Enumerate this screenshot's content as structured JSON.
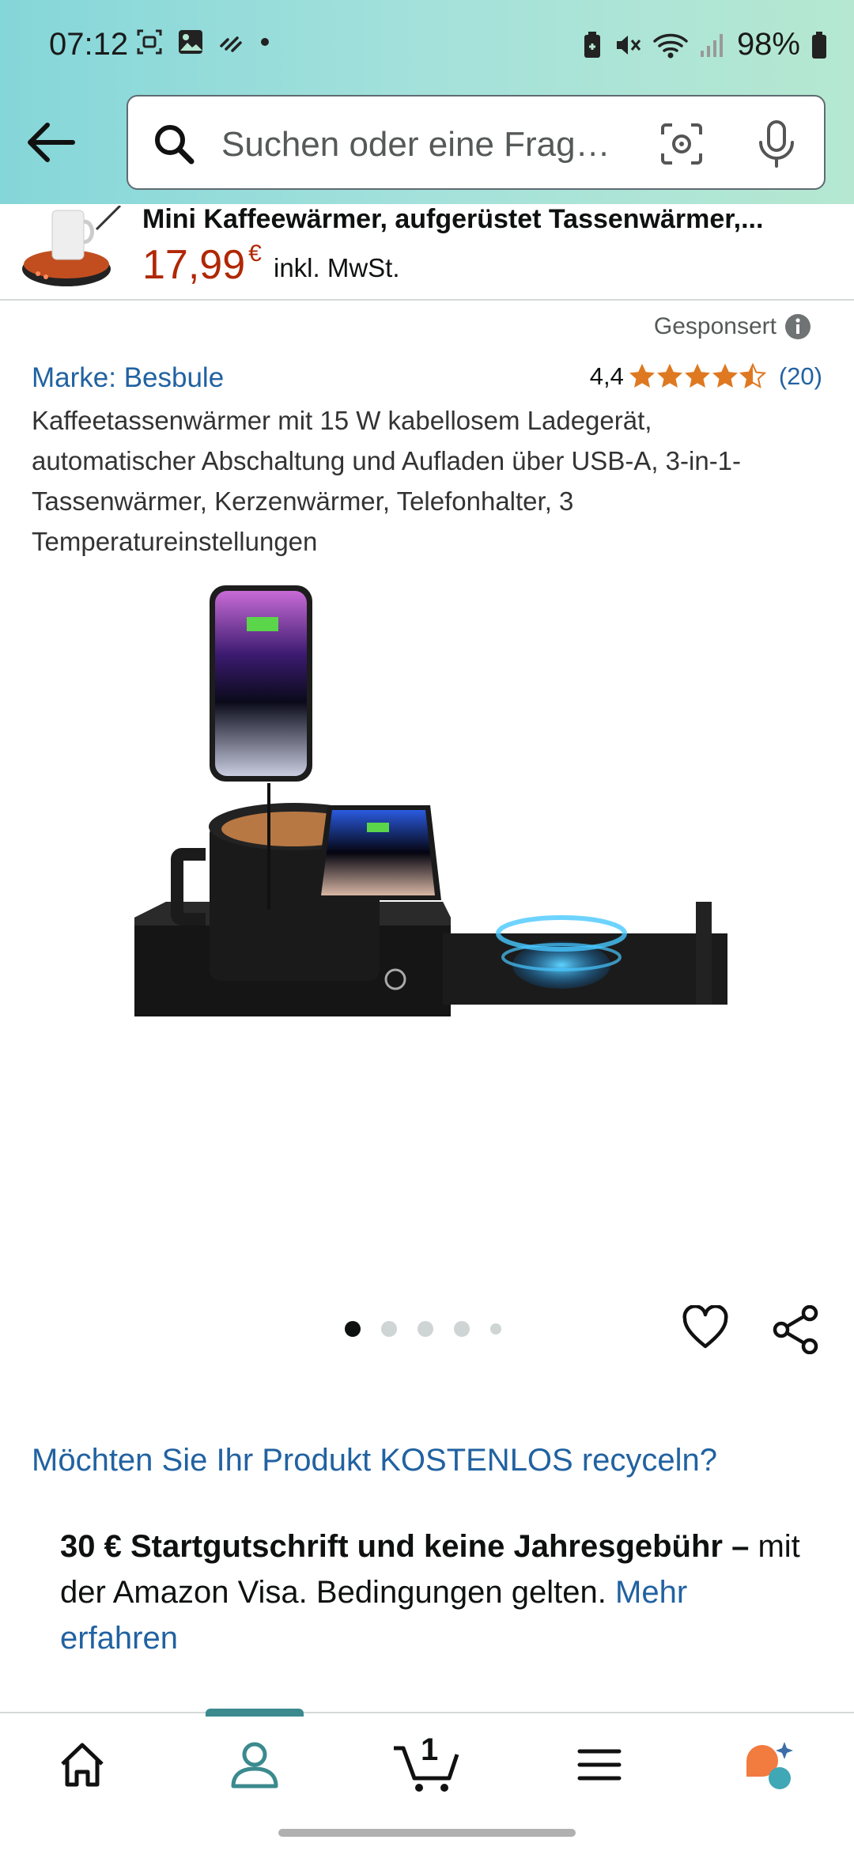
{
  "status_bar": {
    "time": "07:12",
    "battery": "98%"
  },
  "search": {
    "placeholder": "Suchen oder eine Frag…"
  },
  "sticky_product": {
    "title": "Mini Kaffeewärmer, aufgerüstet Tassenwärmer,...",
    "price": "17,99",
    "currency": "€",
    "vat_note": "inkl. MwSt."
  },
  "sponsored_label": "Gesponsert",
  "brand": "Marke: Besbule",
  "rating": {
    "value": "4,4",
    "stars": 4.5,
    "count": "(20)"
  },
  "product_title": "Kaffeetassenwärmer mit 15 W kabellosem Ladegerät, automatischer Abschaltung und Aufladen über USB-A, 3-in-1-Tassenwärmer, Kerzenwärmer, Telefonhalter, 3 Temperatureinstellungen",
  "image_carousel": {
    "count": 5,
    "active_index": 0
  },
  "recycle_link": "Möchten Sie Ihr Produkt KOSTENLOS recyceln?",
  "promo": {
    "bold": "30 € Startgutschrift und keine Jahresgebühr –",
    "text": " mit der Amazon Visa. Bedingungen gelten. ",
    "link": "Mehr erfahren"
  },
  "bottom_nav": {
    "cart_count": "1",
    "active": "account"
  },
  "colors": {
    "link": "#2162a1",
    "price": "#b12704",
    "star": "#de7921",
    "accent": "#3b8a8e"
  }
}
